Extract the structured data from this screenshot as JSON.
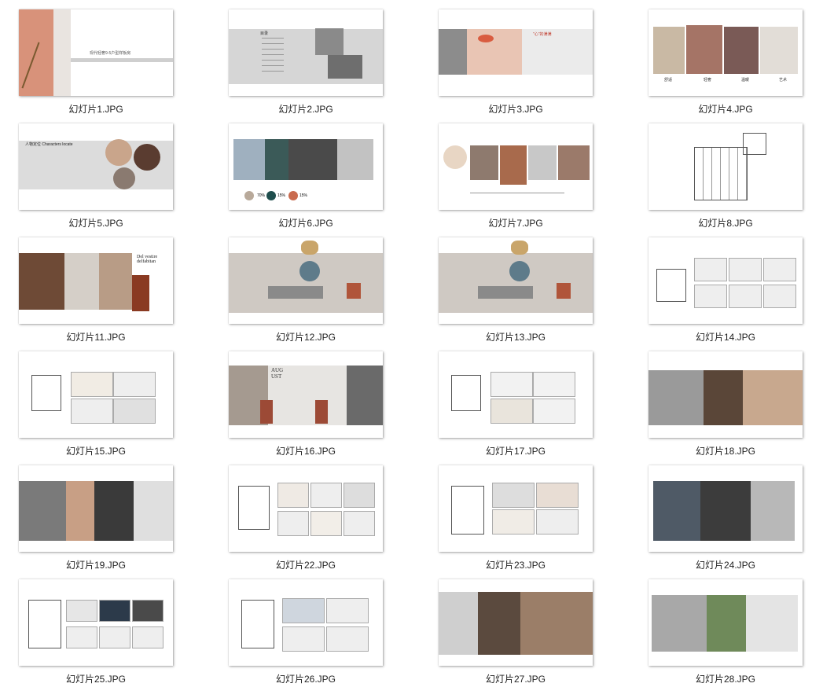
{
  "files": [
    {
      "name": "幻灯片1.JPG"
    },
    {
      "name": "幻灯片2.JPG"
    },
    {
      "name": "幻灯片3.JPG"
    },
    {
      "name": "幻灯片4.JPG"
    },
    {
      "name": "幻灯片5.JPG"
    },
    {
      "name": "幻灯片6.JPG"
    },
    {
      "name": "幻灯片7.JPG"
    },
    {
      "name": "幻灯片8.JPG"
    },
    {
      "name": "幻灯片11.JPG"
    },
    {
      "name": "幻灯片12.JPG"
    },
    {
      "name": "幻灯片13.JPG"
    },
    {
      "name": "幻灯片14.JPG"
    },
    {
      "name": "幻灯片15.JPG"
    },
    {
      "name": "幻灯片16.JPG"
    },
    {
      "name": "幻灯片17.JPG"
    },
    {
      "name": "幻灯片18.JPG"
    },
    {
      "name": "幻灯片19.JPG"
    },
    {
      "name": "幻灯片22.JPG"
    },
    {
      "name": "幻灯片23.JPG"
    },
    {
      "name": "幻灯片24.JPG"
    },
    {
      "name": "幻灯片25.JPG"
    },
    {
      "name": "幻灯片26.JPG"
    },
    {
      "name": "幻灯片27.JPG"
    },
    {
      "name": "幻灯片28.JPG"
    }
  ],
  "slide_text": {
    "s1_title": "现代轻奢9-5户型样板房",
    "s2_title": "目录",
    "s3_title": "\"心\"的满满",
    "s4_labels": [
      "舒适",
      "轻奢",
      "温暖",
      "艺术"
    ],
    "s5_title": "人物定位 Characters locate",
    "s6_pcts": [
      "70%",
      "15%",
      "15%"
    ],
    "s11_title": "Del vestire delfabitan",
    "s16_title": "AUG UST"
  }
}
